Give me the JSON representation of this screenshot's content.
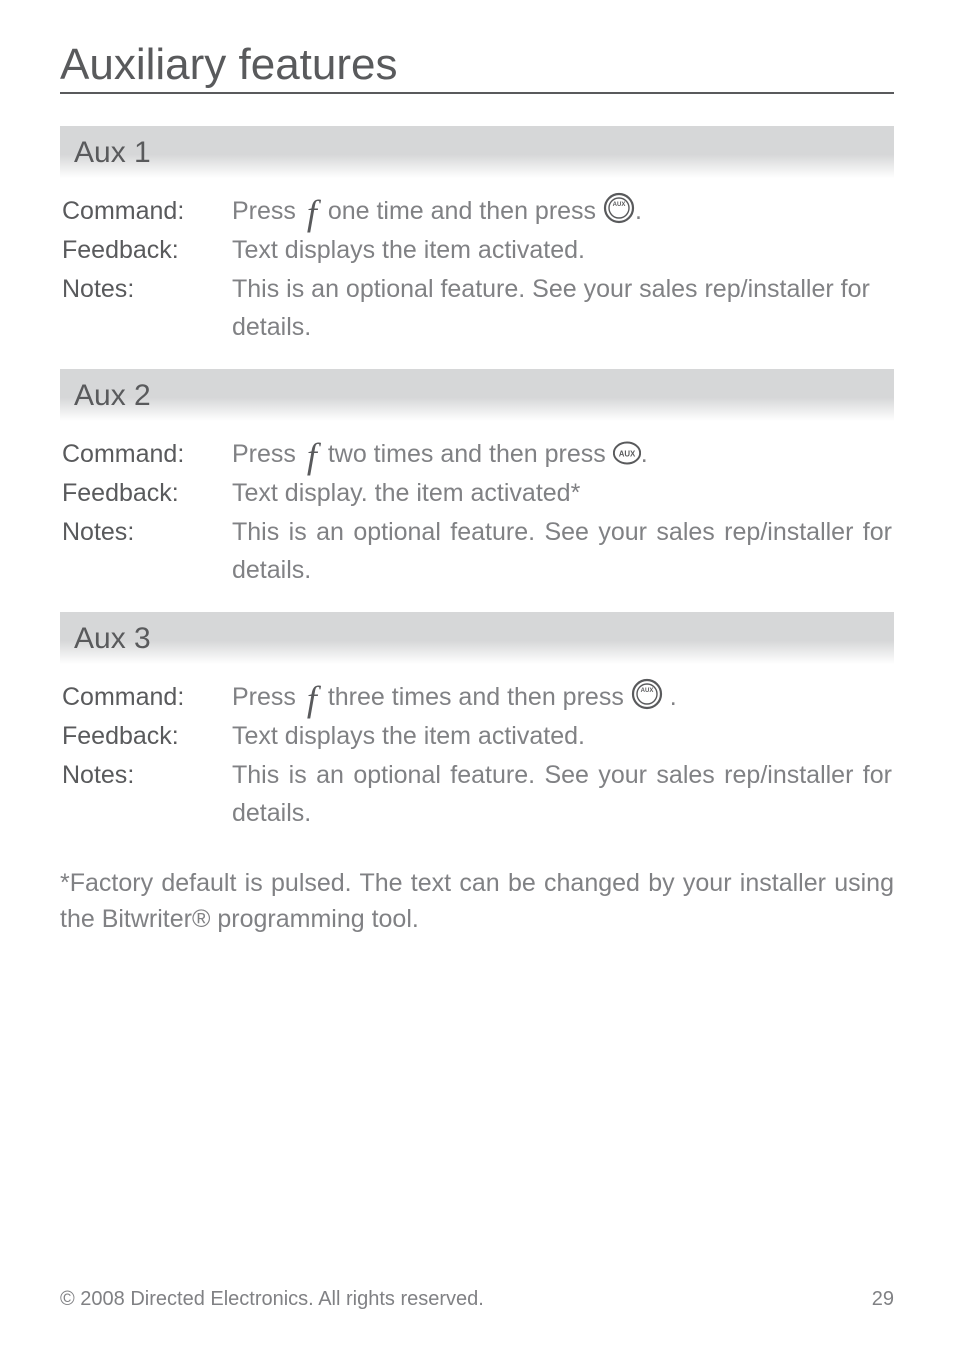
{
  "page": {
    "title": "Auxiliary features",
    "copyright": "© 2008 Directed Electronics. All rights reserved.",
    "page_number": "29"
  },
  "labels": {
    "command": "Command",
    "feedback": "Feedback",
    "notes": "Notes"
  },
  "icons": {
    "f": "f",
    "aux": "AUX"
  },
  "aux1": {
    "heading": "Aux 1",
    "command_pre": "Press ",
    "command_mid": " one time and then press ",
    "command_post": ".",
    "feedback": "Text displays the item activated.",
    "notes": "This is an optional feature. See your sales rep/installer for details."
  },
  "aux2": {
    "heading": "Aux 2",
    "command_pre": "Press ",
    "command_mid": "  two times and then press ",
    "command_post": ".",
    "feedback": "Text display. the item activated*",
    "notes": "This is an optional feature. See your sales rep/installer for de­tails."
  },
  "aux3": {
    "heading": "Aux 3",
    "command_pre": "Press ",
    "command_mid": "  three times and then press ",
    "command_post": " .",
    "feedback": "Text displays the item activated.",
    "notes": "This is an optional feature. See your sales rep/installer for de­tails."
  },
  "footnote": "*Factory default is pulsed. The text can be changed by your installer using the Bitwriter® programming tool."
}
